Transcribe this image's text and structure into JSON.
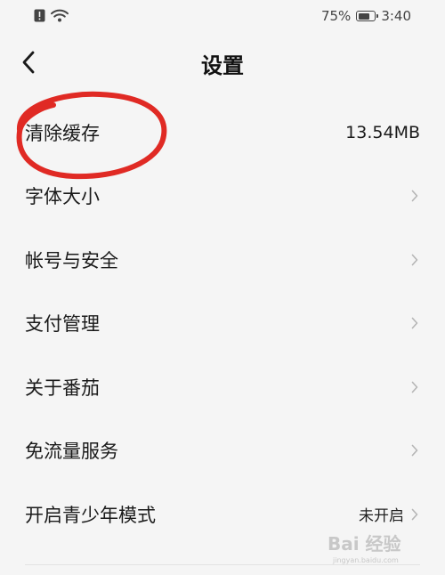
{
  "status_bar": {
    "battery_percent_text": "75%",
    "battery_level": 0.75,
    "time": "3:40"
  },
  "header": {
    "title": "设置"
  },
  "settings": {
    "items": [
      {
        "label": "清除缓存",
        "value": "13.54MB"
      },
      {
        "label": "字体大小"
      },
      {
        "label": "帐号与安全"
      },
      {
        "label": "支付管理"
      },
      {
        "label": "关于番茄"
      },
      {
        "label": "免流量服务"
      },
      {
        "label": "开启青少年模式",
        "value": "未开启"
      }
    ]
  },
  "annotation": {
    "circle_color": "#e02a24"
  },
  "watermark": {
    "text": "Bai 经验",
    "url": "jingyan.baidu.com"
  },
  "icons": {
    "back": "chevron-left-icon",
    "row_arrow": "chevron-right-icon",
    "notification": "alert-icon",
    "wifi": "wifi-icon",
    "battery": "battery-icon"
  }
}
